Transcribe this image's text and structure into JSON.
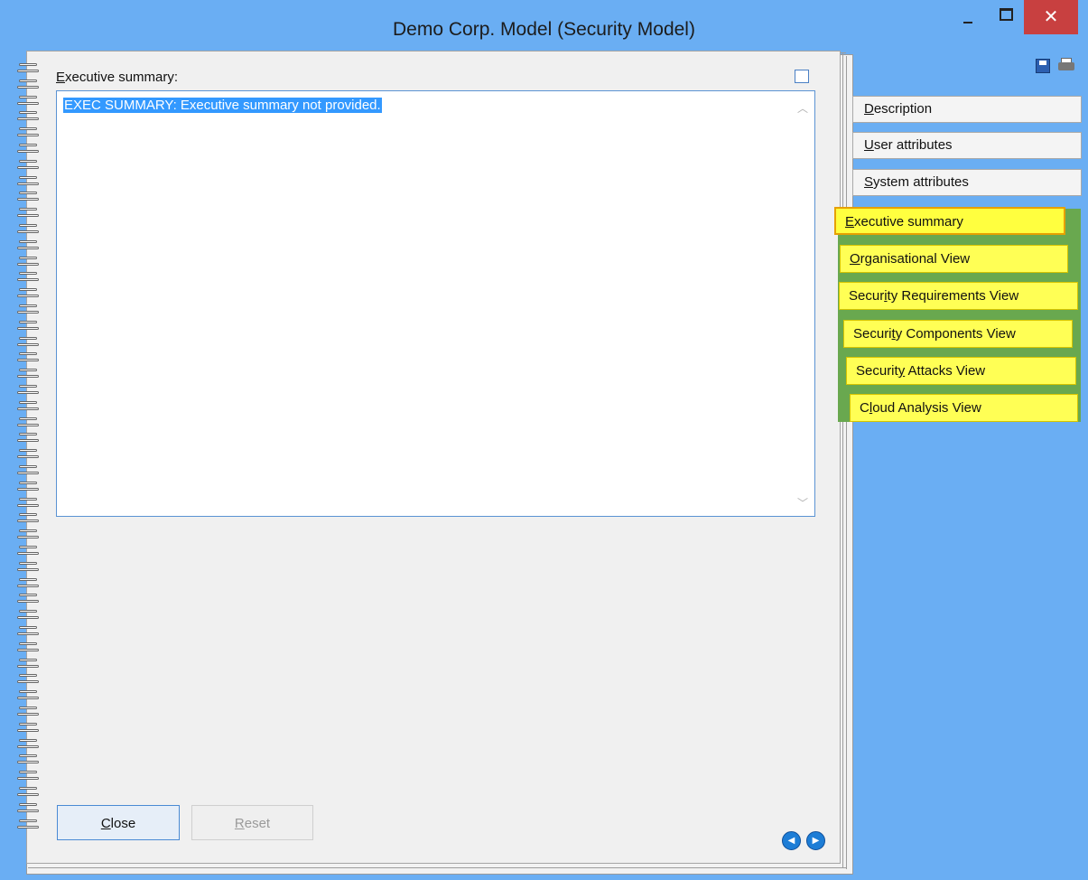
{
  "window": {
    "title": "Demo Corp. Model (Security Model)",
    "close_glyph": "✕"
  },
  "panel": {
    "summary_label": "Executive summary:",
    "summary_text": "EXEC SUMMARY: Executive summary not provided.",
    "close_button": "Close",
    "reset_button": "Reset"
  },
  "toolbar": {
    "save_icon": "save-icon",
    "print_icon": "print-icon"
  },
  "tabs": {
    "gray": [
      "Description",
      "User attributes",
      "System attributes"
    ],
    "yellow": [
      "Executive summary",
      "Organisational View",
      "Security Requirements View",
      "Security Components View",
      "Security Attacks View",
      "Cloud Analysis View"
    ],
    "active": "Executive summary"
  },
  "colors": {
    "desktop": "#6aaef3",
    "selection": "#3399ff",
    "tab_highlight": "#ffff55",
    "tab_group": "#69a84f",
    "close_button": "#c84040"
  }
}
